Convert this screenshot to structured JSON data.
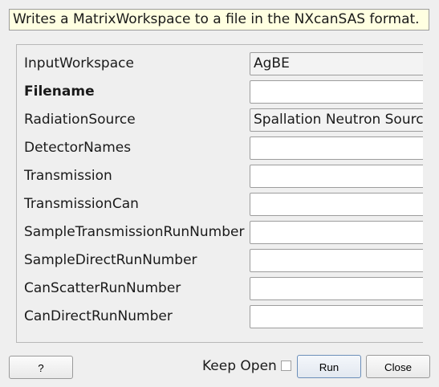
{
  "description": "Writes a MatrixWorkspace to a file in the NXcanSAS format.",
  "properties": [
    {
      "label": "InputWorkspace",
      "value": "AgBE",
      "bold": false,
      "kind": "combo"
    },
    {
      "label": "Filename",
      "value": "",
      "bold": true,
      "kind": "text"
    },
    {
      "label": "RadiationSource",
      "value": "Spallation Neutron Source",
      "bold": false,
      "kind": "combo"
    },
    {
      "label": "DetectorNames",
      "value": "",
      "bold": false,
      "kind": "text"
    },
    {
      "label": "Transmission",
      "value": "",
      "bold": false,
      "kind": "text"
    },
    {
      "label": "TransmissionCan",
      "value": "",
      "bold": false,
      "kind": "text"
    },
    {
      "label": "SampleTransmissionRunNumber",
      "value": "",
      "bold": false,
      "kind": "text"
    },
    {
      "label": "SampleDirectRunNumber",
      "value": "",
      "bold": false,
      "kind": "text"
    },
    {
      "label": "CanScatterRunNumber",
      "value": "",
      "bold": false,
      "kind": "text"
    },
    {
      "label": "CanDirectRunNumber",
      "value": "",
      "bold": false,
      "kind": "text"
    }
  ],
  "buttons": {
    "help": "?",
    "keep_open_label": "Keep Open",
    "keep_open_checked": false,
    "run": "Run",
    "close": "Close"
  }
}
